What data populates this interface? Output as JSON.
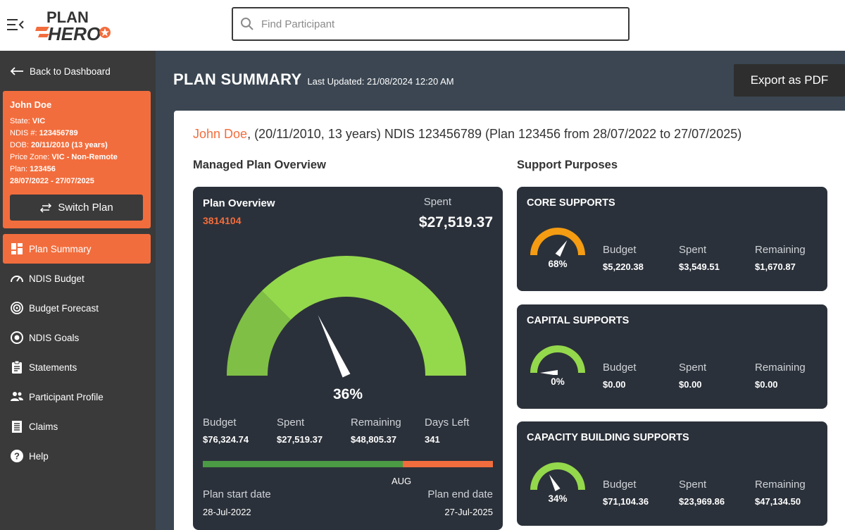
{
  "header": {
    "logo_top": "PLAN",
    "logo_bottom": "HERO",
    "search_placeholder": "Find Participant"
  },
  "sidebar": {
    "back_label": "Back to Dashboard",
    "participant": {
      "name": "John Doe",
      "state_label": "State: ",
      "state": "VIC",
      "ndis_label": "NDIS #: ",
      "ndis": "123456789",
      "dob_label": "DOB: ",
      "dob": "20/11/2010  (13 years)",
      "price_zone_label": "Price Zone: ",
      "price_zone": "VIC - Non-Remote",
      "plan_label": "Plan: ",
      "plan": "123456",
      "plan_dates": "28/07/2022 - 27/07/2025"
    },
    "switch_label": "Switch Plan",
    "nav": [
      {
        "label": "Plan Summary",
        "icon": "dashboard-icon",
        "active": true
      },
      {
        "label": "NDIS Budget",
        "icon": "speedometer-icon"
      },
      {
        "label": "Budget Forecast",
        "icon": "target-icon"
      },
      {
        "label": "NDIS Goals",
        "icon": "goal-circle-icon"
      },
      {
        "label": "Statements",
        "icon": "clipboard-icon"
      },
      {
        "label": "Participant Profile",
        "icon": "people-icon"
      },
      {
        "label": "Claims",
        "icon": "list-icon"
      },
      {
        "label": "Help",
        "icon": "help-icon"
      }
    ]
  },
  "main": {
    "title": "PLAN SUMMARY",
    "last_updated": "Last Updated: 21/08/2024 12:20 AM",
    "export_label": "Export as PDF",
    "plan_line_name": "John Doe",
    "plan_line_rest": ", (20/11/2010, 13 years) NDIS 123456789 (Plan 123456 from 28/07/2022 to 27/07/2025)",
    "overview_section": "Managed Plan Overview",
    "support_section": "Support Purposes"
  },
  "overview": {
    "title": "Plan Overview",
    "id": "3814104",
    "spent_label": "Spent",
    "spent": "$27,519.37",
    "percent": 36,
    "percent_label": "36%",
    "stats": [
      {
        "label": "Budget",
        "value": "$76,324.74"
      },
      {
        "label": "Spent",
        "value": "$27,519.37"
      },
      {
        "label": "Remaining",
        "value": "$48,805.37"
      },
      {
        "label": "Days Left",
        "value": "341"
      }
    ],
    "time_elapsed_fraction": 0.69,
    "current_month": "AUG",
    "start_label": "Plan start date",
    "start_date": "28-Jul-2022",
    "end_label": "Plan end date",
    "end_date": "27-Jul-2025",
    "colors": {
      "light": "#94d84c",
      "dark": "#7fbf46",
      "progress_done": "#4b9a44",
      "progress_left": "#f26d3d"
    }
  },
  "supports": [
    {
      "title": "CORE SUPPORTS",
      "percent": 68,
      "percent_label": "68%",
      "color": "#f59c12",
      "budget_label": "Budget",
      "budget": "$5,220.38",
      "spent_label": "Spent",
      "spent": "$3,549.51",
      "remaining_label": "Remaining",
      "remaining": "$1,670.87"
    },
    {
      "title": "CAPITAL SUPPORTS",
      "percent": 0,
      "percent_label": "0%",
      "color": "#94d84c",
      "budget_label": "Budget",
      "budget": "$0.00",
      "spent_label": "Spent",
      "spent": "$0.00",
      "remaining_label": "Remaining",
      "remaining": "$0.00"
    },
    {
      "title": "CAPACITY BUILDING SUPPORTS",
      "percent": 34,
      "percent_label": "34%",
      "color": "#94d84c",
      "budget_label": "Budget",
      "budget": "$71,104.36",
      "spent_label": "Spent",
      "spent": "$23,969.86",
      "remaining_label": "Remaining",
      "remaining": "$47,134.50"
    }
  ]
}
